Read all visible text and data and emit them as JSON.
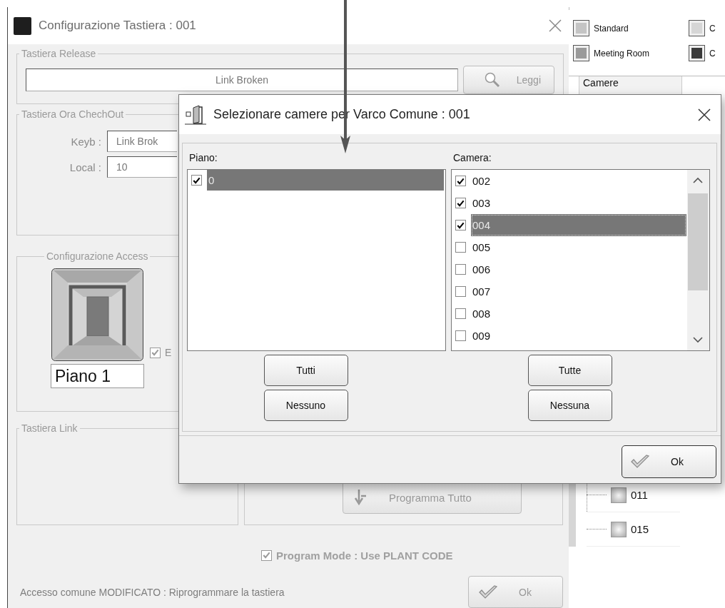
{
  "main_window": {
    "title": "Configurazione  Tastiera : 001",
    "release_group": {
      "title": "Tastiera Release",
      "field": "Link Broken",
      "read_button": "Leggi"
    },
    "checkout_group": {
      "title": "Tastiera Ora ChechOut",
      "rows": [
        {
          "label": "Keyb :",
          "value": "Link Brok"
        },
        {
          "label": "Local :",
          "value": "10"
        }
      ]
    },
    "access_group": {
      "title": "Configurazione Access",
      "checkbox": {
        "label": "E",
        "checked": true
      },
      "floor_field": "Piano 1"
    },
    "link_group": {
      "title": "Tastiera Link"
    },
    "program_all_button": "Programma Tutto",
    "program_mode": {
      "label": "Program Mode : Use PLANT CODE",
      "checked": true
    },
    "status": "Accesso comune MODIFICATO : Riprogrammare la tastiera",
    "ok_button": "Ok"
  },
  "side_panel": {
    "legend": [
      {
        "label": "Standard",
        "color": "#c4c4c4"
      },
      {
        "label": "C",
        "color": "#d6d6d6"
      },
      {
        "label": "Meeting Room",
        "color": "#9a9a9a"
      },
      {
        "label": "C",
        "color": "#3a3a3a"
      }
    ],
    "table_header": "Camere",
    "tree": [
      {
        "label": "011"
      },
      {
        "label": "015"
      }
    ]
  },
  "dialog": {
    "title": "Selezionare camere per Varco Comune : 001",
    "floor_label": "Piano:",
    "floors": [
      {
        "label": "0",
        "checked": true,
        "selected": true
      }
    ],
    "room_label": "Camera:",
    "rooms": [
      {
        "label": "002",
        "checked": true,
        "selected": false
      },
      {
        "label": "003",
        "checked": true,
        "selected": false
      },
      {
        "label": "004",
        "checked": true,
        "selected": true
      },
      {
        "label": "005",
        "checked": false,
        "selected": false
      },
      {
        "label": "006",
        "checked": false,
        "selected": false
      },
      {
        "label": "007",
        "checked": false,
        "selected": false
      },
      {
        "label": "008",
        "checked": false,
        "selected": false
      },
      {
        "label": "009",
        "checked": false,
        "selected": false
      }
    ],
    "floor_buttons": [
      "Tutti",
      "Nessuno"
    ],
    "room_buttons": [
      "Tutte",
      "Nessuna"
    ],
    "ok_button": "Ok"
  }
}
